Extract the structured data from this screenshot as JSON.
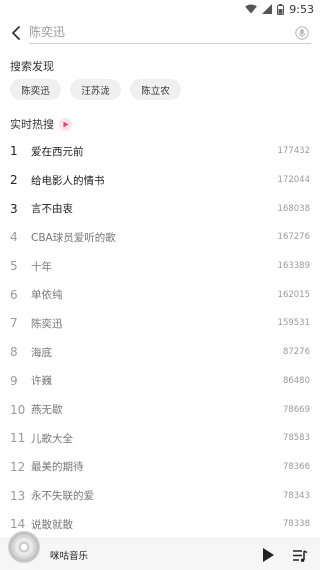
{
  "status": {
    "time": "9:53"
  },
  "search": {
    "placeholder": "陈奕迅"
  },
  "discover": {
    "title": "搜索发现",
    "chips": [
      "陈奕迅",
      "汪苏泷",
      "陈立农"
    ]
  },
  "hot": {
    "title": "实时热搜",
    "items": [
      {
        "rank": "1",
        "name": "爱在西元前",
        "count": "177432"
      },
      {
        "rank": "2",
        "name": "给电影人的情书",
        "count": "172044"
      },
      {
        "rank": "3",
        "name": "言不由衷",
        "count": "168038"
      },
      {
        "rank": "4",
        "name": "CBA球员爱听的歌",
        "count": "167276"
      },
      {
        "rank": "5",
        "name": "十年",
        "count": "163389"
      },
      {
        "rank": "6",
        "name": "单依纯",
        "count": "162015"
      },
      {
        "rank": "7",
        "name": "陈奕迅",
        "count": "159531"
      },
      {
        "rank": "8",
        "name": "海底",
        "count": "87276"
      },
      {
        "rank": "9",
        "name": "许巍",
        "count": "86480"
      },
      {
        "rank": "10",
        "name": "燕无歇",
        "count": "78669"
      },
      {
        "rank": "11",
        "name": "儿歌大全",
        "count": "78583"
      },
      {
        "rank": "12",
        "name": "最美的期待",
        "count": "78366"
      },
      {
        "rank": "13",
        "name": "永不失联的爱",
        "count": "78343"
      },
      {
        "rank": "14",
        "name": "说散就散",
        "count": "78338"
      }
    ]
  },
  "player": {
    "title": "咪咕音乐"
  },
  "colors": {
    "accent": "#e8386f",
    "chip_bg": "#f0f0f0",
    "player_bg": "#f6f6f6"
  },
  "icons": [
    "wifi-icon",
    "signal-icon",
    "battery-icon",
    "back-arrow-icon",
    "voice-search-icon",
    "play-triangle-icon",
    "disc-icon",
    "play-icon",
    "playlist-icon"
  ]
}
